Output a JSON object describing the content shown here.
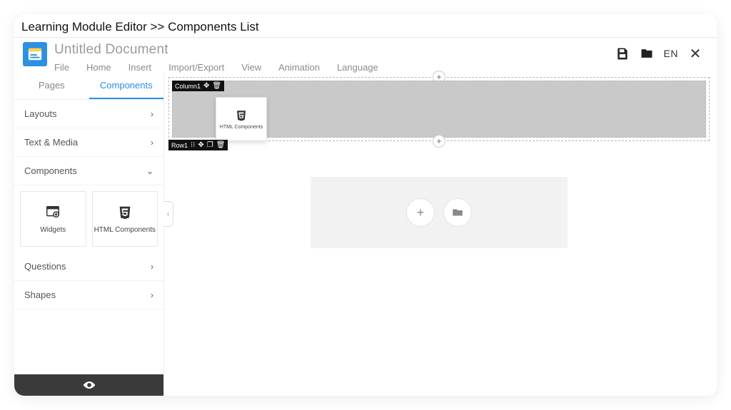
{
  "breadcrumb": "Learning Module Editor >> Components List",
  "document": {
    "title": "Untitled Document"
  },
  "menu": {
    "file": "File",
    "home": "Home",
    "insert": "Insert",
    "import_export": "Import/Export",
    "view": "View",
    "animation": "Animation",
    "language": "Language"
  },
  "topActions": {
    "lang": "EN"
  },
  "sidebar": {
    "tabs": {
      "pages": "Pages",
      "components": "Components"
    },
    "sections": {
      "layouts": "Layouts",
      "text_media": "Text & Media",
      "components": "Components",
      "questions": "Questions",
      "shapes": "Shapes"
    },
    "cards": {
      "widgets": "Widgets",
      "html_components": "HTML Components"
    }
  },
  "canvas": {
    "column_label": "Column1",
    "row_label": "Row1",
    "dropped_label": "HTML Components"
  }
}
